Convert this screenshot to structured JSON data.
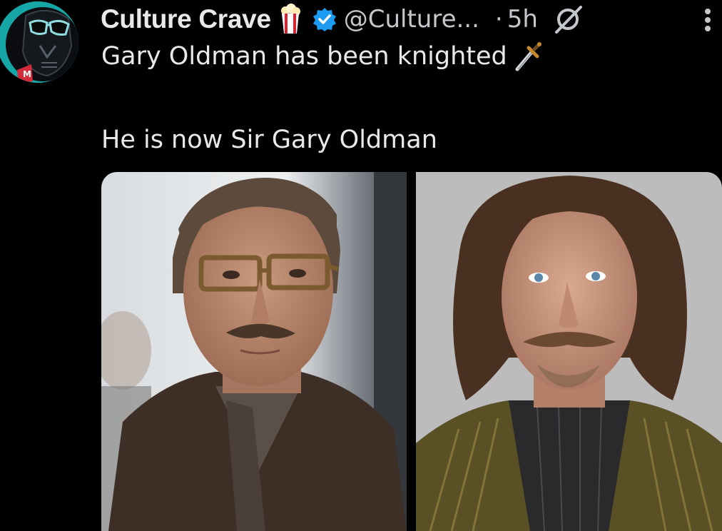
{
  "author": {
    "display_name": "Culture Crave",
    "handle": "@Culture...",
    "separator": "·",
    "age": "5h",
    "avatar_icon": "darth-vader-avatar",
    "badges": [
      "popcorn-icon",
      "verified-badge-icon"
    ]
  },
  "tweet": {
    "line1": "Gary Oldman has been knighted",
    "line1_emoji": "dagger-icon",
    "line2": "He is now Sir Gary Oldman"
  },
  "media": {
    "count": 2,
    "images": [
      {
        "subject": "man-with-glasses-and-mustache-trenchcoat"
      },
      {
        "subject": "man-with-long-curly-hair-striped-jacket"
      }
    ]
  },
  "colors": {
    "background": "#000000",
    "text_primary": "#e7e9ea",
    "text_secondary": "#c4c8cc",
    "verified_blue": "#1d9bf0",
    "avatar_teal": "#16a6a6"
  }
}
